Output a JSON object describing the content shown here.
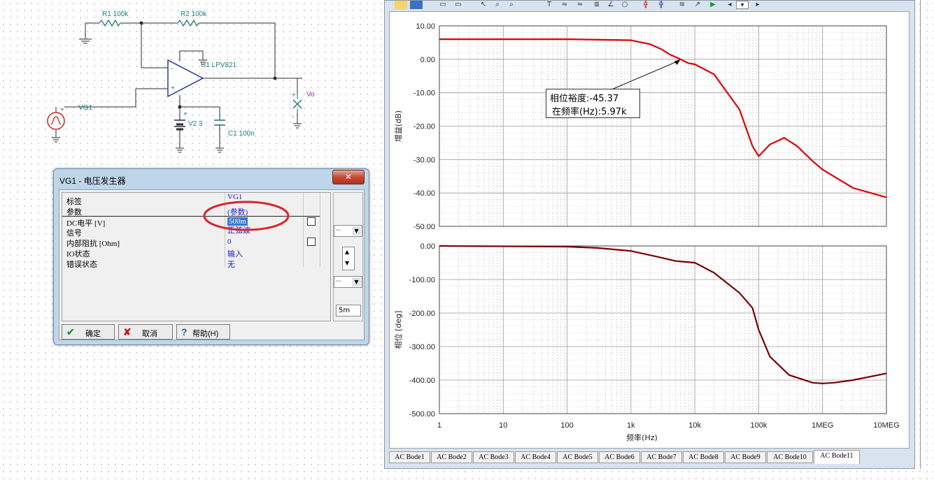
{
  "schematic": {
    "r1": "R1 100k",
    "r2": "R2 100k",
    "u1": "U1 LPV821",
    "vg1": "VG1",
    "v2": "V2 3",
    "c1": "C1 100n",
    "vo": "Vo",
    "plus": "+",
    "minus": "-"
  },
  "dialog": {
    "title": "VG1 - 电压发生器",
    "close_glyph": "✕",
    "rows": [
      {
        "key": "标签",
        "value": "VG1"
      },
      {
        "key": "参数",
        "value": "(参数)"
      },
      {
        "key": "DC电平 [V]",
        "value": "500m"
      },
      {
        "key": "信号",
        "value": "正弦波"
      },
      {
        "key": "内部阻抗 [Ohm]",
        "value": "0"
      },
      {
        "key": "IO状态",
        "value": "输入"
      },
      {
        "key": "错误状态",
        "value": "无"
      }
    ],
    "side": {
      "combo1": "--",
      "combo2": "--",
      "field": "5m"
    },
    "buttons": {
      "ok": {
        "icon": "✔",
        "label": "确定"
      },
      "cancel": {
        "icon": "✘",
        "label": "取消"
      },
      "help": {
        "icon": "?",
        "label": "帮助(H)"
      }
    }
  },
  "bode": {
    "annotation": {
      "line1": "相位裕度:-45.37",
      "line2": "在频率(Hz):5.97k"
    },
    "tabs": [
      "AC Bode1",
      "AC Bode2",
      "AC Bode3",
      "AC Bode4",
      "AC Bode5",
      "AC Bode6",
      "AC Bode7",
      "AC Bode8",
      "AC Bode9",
      "AC Bode10",
      "AC Bode11"
    ],
    "active_tab": 10
  },
  "chart_data": [
    {
      "type": "line",
      "ylabel": "增益(dB)",
      "xscale": "log",
      "xlim": [
        1,
        10000000
      ],
      "ylim": [
        -50,
        10
      ],
      "yticks": [
        "10.00",
        "0.00",
        "-10.00",
        "-20.00",
        "-30.00",
        "-40.00",
        "-50.00"
      ],
      "grid": true,
      "series": [
        {
          "color": "#e00000",
          "x": [
            1,
            100,
            1000,
            2000,
            3000,
            4000,
            5970,
            8000,
            10000,
            20000,
            50000,
            80000,
            100000,
            150000,
            250000,
            400000,
            700000,
            1000000,
            3000000,
            10000000
          ],
          "y": [
            6,
            6,
            5.7,
            4.5,
            3,
            1.5,
            0,
            -1.2,
            -1.5,
            -4.5,
            -15,
            -26,
            -29,
            -25.5,
            -23.5,
            -26,
            -30.5,
            -33,
            -38.5,
            -41.3
          ]
        }
      ]
    },
    {
      "type": "line",
      "ylabel": "相位 [deg]",
      "xlabel": "频率(Hz)",
      "xscale": "log",
      "xlim": [
        1,
        10000000
      ],
      "ylim": [
        -500,
        0
      ],
      "yticks": [
        "0.00",
        "-100.00",
        "-200.00",
        "-300.00",
        "-400.00",
        "-500.00"
      ],
      "xticks": [
        "1",
        "10",
        "100",
        "1k",
        "10k",
        "100k",
        "1MEG",
        "10MEG"
      ],
      "grid": true,
      "series": [
        {
          "color": "#7a0000",
          "x": [
            1,
            100,
            300,
            1000,
            3000,
            5000,
            10000,
            20000,
            50000,
            80000,
            100000,
            150000,
            300000,
            700000,
            1000000,
            1500000,
            3000000,
            10000000
          ],
          "y": [
            0,
            -2,
            -6,
            -15,
            -35,
            -45,
            -50,
            -80,
            -140,
            -185,
            -250,
            -330,
            -385,
            -408,
            -410,
            -408,
            -400,
            -380
          ]
        }
      ]
    }
  ]
}
